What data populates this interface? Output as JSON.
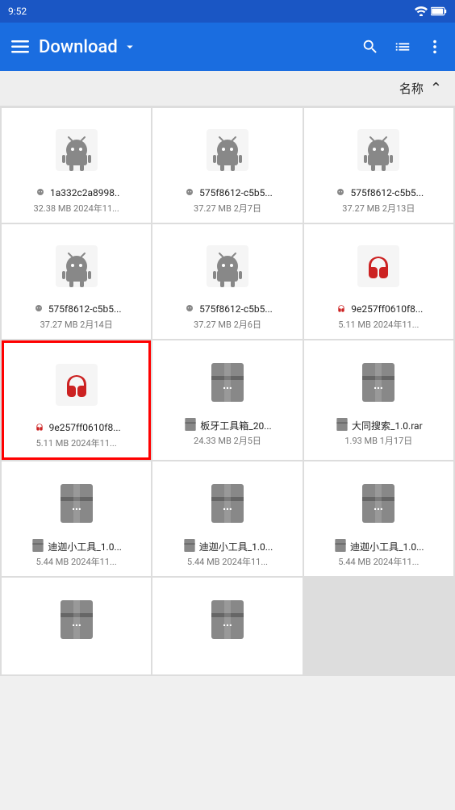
{
  "statusBar": {
    "time": "9:52",
    "icons": [
      "notification",
      "download",
      "a-icon"
    ]
  },
  "appBar": {
    "menuIcon": "hamburger-menu",
    "title": "Download",
    "dropdownIcon": "chevron-down",
    "searchIcon": "search",
    "listViewIcon": "list-view",
    "moreIcon": "more-vertical"
  },
  "sortBar": {
    "label": "名称",
    "direction": "ascending"
  },
  "files": [
    {
      "id": "f1",
      "name": "1a332c2a8998..",
      "size": "32.38 MB",
      "date": "2024年11...",
      "type": "apk",
      "selected": false
    },
    {
      "id": "f2",
      "name": "575f8612-c5b5...",
      "size": "37.27 MB",
      "date": "2月7日",
      "type": "apk",
      "selected": false
    },
    {
      "id": "f3",
      "name": "575f8612-c5b5...",
      "size": "37.27 MB",
      "date": "2月13日",
      "type": "apk",
      "selected": false
    },
    {
      "id": "f4",
      "name": "575f8612-c5b5...",
      "size": "37.27 MB",
      "date": "2月14日",
      "type": "apk",
      "selected": false
    },
    {
      "id": "f5",
      "name": "575f8612-c5b5...",
      "size": "37.27 MB",
      "date": "2月6日",
      "type": "apk",
      "selected": false
    },
    {
      "id": "f6",
      "name": "9e257ff0610f8...",
      "size": "5.11 MB",
      "date": "2024年11...",
      "type": "headphone",
      "selected": false
    },
    {
      "id": "f7",
      "name": "9e257ff0610f8...",
      "size": "5.11 MB",
      "date": "2024年11...",
      "type": "headphone",
      "selected": true
    },
    {
      "id": "f8",
      "name": "板牙工具箱_20...",
      "size": "24.33 MB",
      "date": "2月5日",
      "type": "rar",
      "selected": false
    },
    {
      "id": "f9",
      "name": "大同搜索_1.0.rar",
      "size": "1.93 MB",
      "date": "1月17日",
      "type": "rar",
      "selected": false
    },
    {
      "id": "f10",
      "name": "迪迦小工具_1.0...",
      "size": "5.44 MB",
      "date": "2024年11...",
      "type": "rar",
      "selected": false
    },
    {
      "id": "f11",
      "name": "迪迦小工具_1.0...",
      "size": "5.44 MB",
      "date": "2024年11...",
      "type": "rar",
      "selected": false
    },
    {
      "id": "f12",
      "name": "迪迦小工具_1.0...",
      "size": "5.44 MB",
      "date": "2024年11...",
      "type": "rar",
      "selected": false
    },
    {
      "id": "f13",
      "name": "...",
      "size": "",
      "date": "",
      "type": "rar",
      "selected": false
    },
    {
      "id": "f14",
      "name": "...",
      "size": "",
      "date": "",
      "type": "rar",
      "selected": false
    }
  ]
}
